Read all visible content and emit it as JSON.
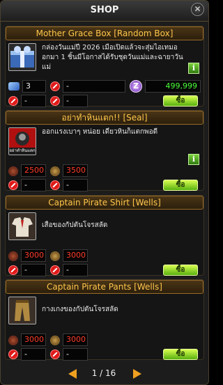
{
  "window": {
    "title": "SHOP",
    "close_glyph": "✕"
  },
  "items": [
    {
      "header": "Mother Grace Box [Random Box]",
      "thumb_icon": "gift-box-icon",
      "description": "กล่องวันแม่ปี 2026 เมื่อเปิดแล้วจะสุ่มไอเทมออกมา 1 ชิ้นมีโอกาสได้รับชุดวันแม่และฉายาวันแม่",
      "info_glyph": "i",
      "row1": {
        "left_value": "3",
        "right_value": "-"
      },
      "price_value": "499,999",
      "price_icon_glyph": "Z",
      "row3": {
        "left_value": "-",
        "right_value": "-"
      },
      "buy_label": "ซื้อ"
    },
    {
      "header": "อย่าทำหินแตก!! [Seal]",
      "thumb_icon": "seal-stone-icon",
      "thumb_caption": "อย่าทำหินแตก",
      "description": "ออกแรงเบาๆ หน่อย เดี๋ยวหินก็แตกพอดี",
      "info_glyph": "i",
      "row1": {
        "left_value": "2500",
        "right_value": "3500"
      },
      "row2": {
        "left_value": "-",
        "right_value": "-"
      },
      "buy_label": "ซื้อ"
    },
    {
      "header": "Captain Pirate Shirt [Wells]",
      "thumb_icon": "pirate-shirt-icon",
      "description": "เสื้อของกัปตันโจรสลัด",
      "row1": {
        "left_value": "3000",
        "right_value": "3000"
      },
      "row2": {
        "left_value": "-",
        "right_value": "-"
      },
      "buy_label": "ซื้อ"
    },
    {
      "header": "Captain Pirate Pants [Wells]",
      "thumb_icon": "pirate-pants-icon",
      "description": "กางเกงของกัปตันโจรสลัด",
      "row1": {
        "left_value": "3000",
        "right_value": "3000"
      },
      "row2": {
        "left_value": "-",
        "right_value": "-"
      },
      "buy_label": "ซื้อ"
    }
  ],
  "pagination": {
    "label": "1 / 16",
    "current": 1,
    "total": 16
  },
  "colors": {
    "header_text": "#ffc64a",
    "price_red": "#ff3a28",
    "price_green": "#4cff3a",
    "buy_green": "#58b010",
    "arrow": "#f0a020"
  }
}
